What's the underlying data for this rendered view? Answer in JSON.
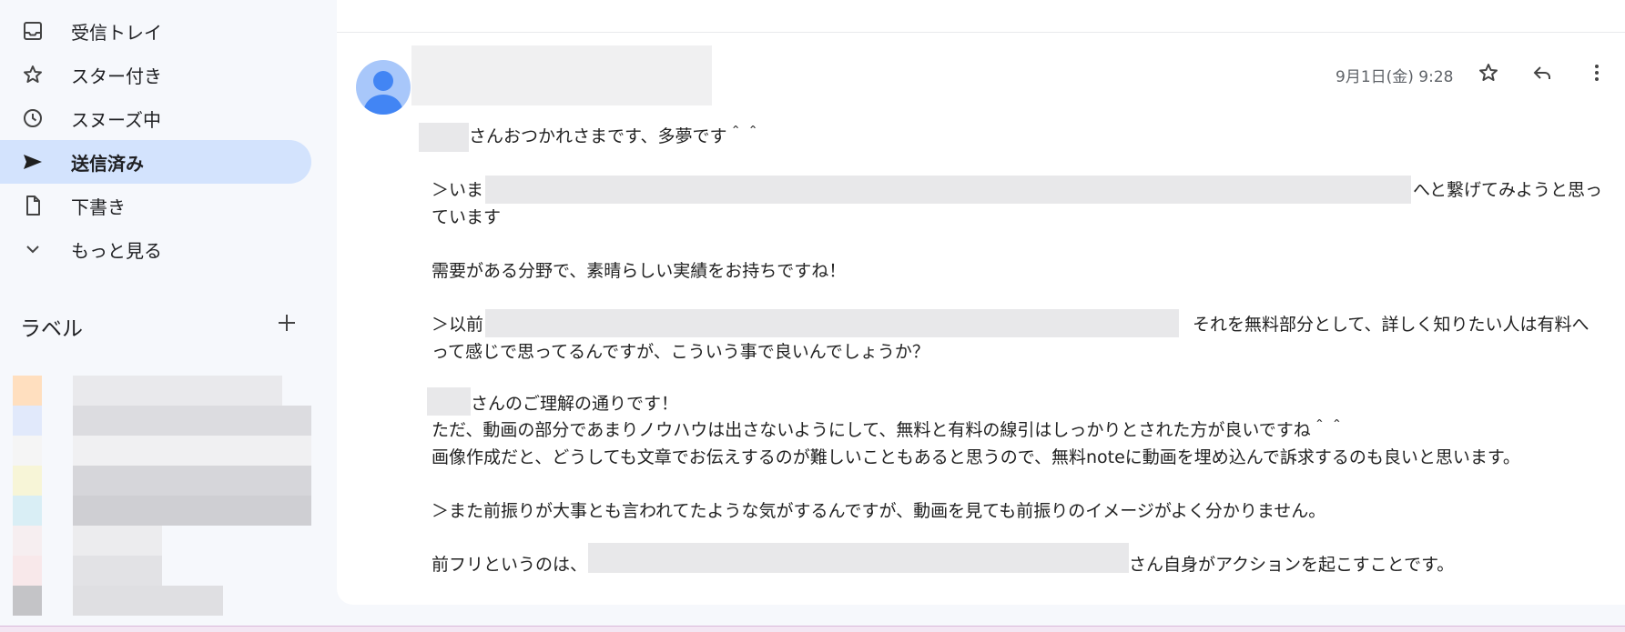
{
  "sidebar": {
    "items": [
      {
        "label": "受信トレイ",
        "icon": "inbox-icon"
      },
      {
        "label": "スター付き",
        "icon": "star-icon"
      },
      {
        "label": "スヌーズ中",
        "icon": "clock-icon"
      },
      {
        "label": "送信済み",
        "icon": "send-icon",
        "active": true
      },
      {
        "label": "下書き",
        "icon": "draft-icon"
      },
      {
        "label": "もっと見る",
        "icon": "chevron-down-icon"
      }
    ],
    "labels_heading": "ラベル",
    "label_colors": [
      "#ffdfbf",
      "#e1e9fb",
      "#f5f5f5",
      "#f7f5d7",
      "#d9eef5",
      "#f6eef0",
      "#f8e8ea",
      "#c4c4c7"
    ]
  },
  "message": {
    "date": "9月1日(金) 9:28",
    "lines": [
      "さんおつかれさまです、多夢です＾＾",
      "＞いま",
      "へと繋げてみようと思っ",
      "ています",
      "需要がある分野で、素晴らしい実績をお持ちですね！",
      "＞以前",
      "それを無料部分として、詳しく知りたい人は有料へ",
      "って感じで思ってるんですが、こういう事で良いんでしょうか？",
      "さんのご理解の通りです！",
      "ただ、動画の部分であまりノウハウは出さないようにして、無料と有料の線引はしっかりとされた方が良いですね＾＾",
      "画像作成だと、どうしても文章でお伝えするのが難しいこともあると思うので、無料noteに動画を埋め込んで訴求するのも良いと思います。",
      "＞また前振りが大事とも言われてたような気がするんですが、動画を見ても前振りのイメージがよく分かりません。",
      "前フリというのは、",
      "さん自身がアクションを起こすことです。"
    ]
  },
  "colors": {
    "active_nav": "#d3e3fd",
    "avatar": "#a8c7fa",
    "avatar_figure": "#4285f4"
  }
}
